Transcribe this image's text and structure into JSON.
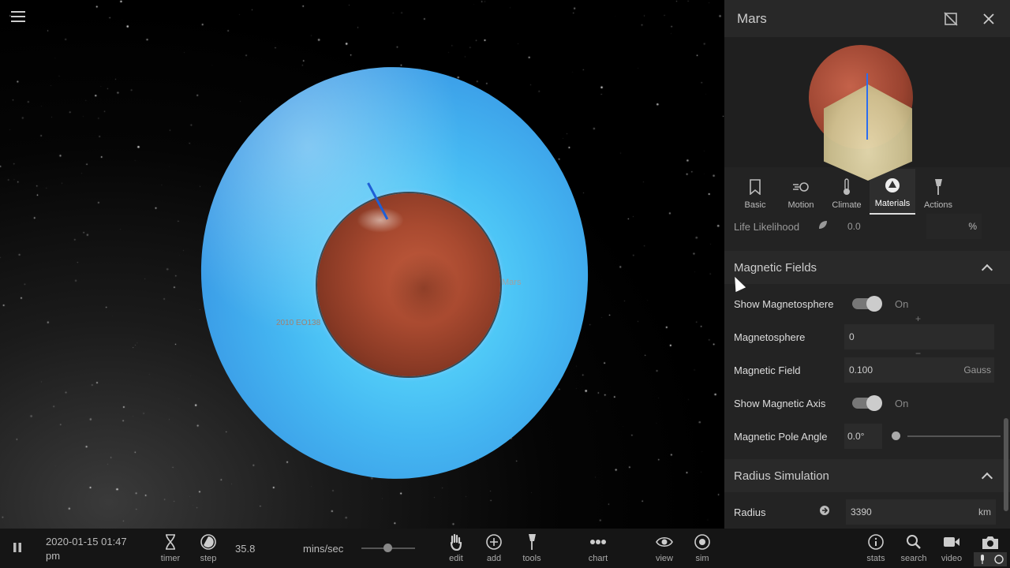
{
  "app": {
    "menu_icon": "hamburger-icon"
  },
  "viewport": {
    "body_label": "Mars",
    "asteroid_label": "2010 EO138"
  },
  "panel": {
    "title": "Mars",
    "hide_icon": "hide-panel-icon",
    "close_icon": "close-icon",
    "tabs": [
      {
        "label": "Basic",
        "icon": "bookmark-icon"
      },
      {
        "label": "Motion",
        "icon": "motion-icon"
      },
      {
        "label": "Climate",
        "icon": "thermometer-icon"
      },
      {
        "label": "Materials",
        "icon": "materials-icon"
      },
      {
        "label": "Actions",
        "icon": "actions-icon"
      }
    ],
    "active_tab": "Materials",
    "life_likelihood": {
      "label": "Life Likelihood",
      "value": "0.0",
      "unit": "%"
    },
    "magnetic_fields": {
      "title": "Magnetic Fields",
      "show_magnetosphere": {
        "label": "Show Magnetosphere",
        "state": "On"
      },
      "magnetosphere": {
        "label": "Magnetosphere",
        "value": "0"
      },
      "magnetic_field": {
        "label": "Magnetic Field",
        "value": "0.100",
        "unit": "Gauss"
      },
      "show_magnetic_axis": {
        "label": "Show Magnetic Axis",
        "state": "On"
      },
      "magnetic_pole_angle": {
        "label": "Magnetic Pole Angle",
        "value": "0.0°"
      }
    },
    "radius_simulation": {
      "title": "Radius Simulation",
      "radius": {
        "label": "Radius",
        "value": "3390",
        "unit": "km"
      }
    }
  },
  "bottom_bar": {
    "datetime_line1": "2020-01-15 01:47",
    "datetime_line2": "pm",
    "timer_label": "timer",
    "step_label": "step",
    "rate_value": "35.8",
    "rate_unit": "mins/sec",
    "edit_label": "edit",
    "add_label": "add",
    "tools_label": "tools",
    "chart_label": "chart",
    "view_label": "view",
    "sim_label": "sim",
    "stats_label": "stats",
    "search_label": "search",
    "video_label": "video"
  }
}
